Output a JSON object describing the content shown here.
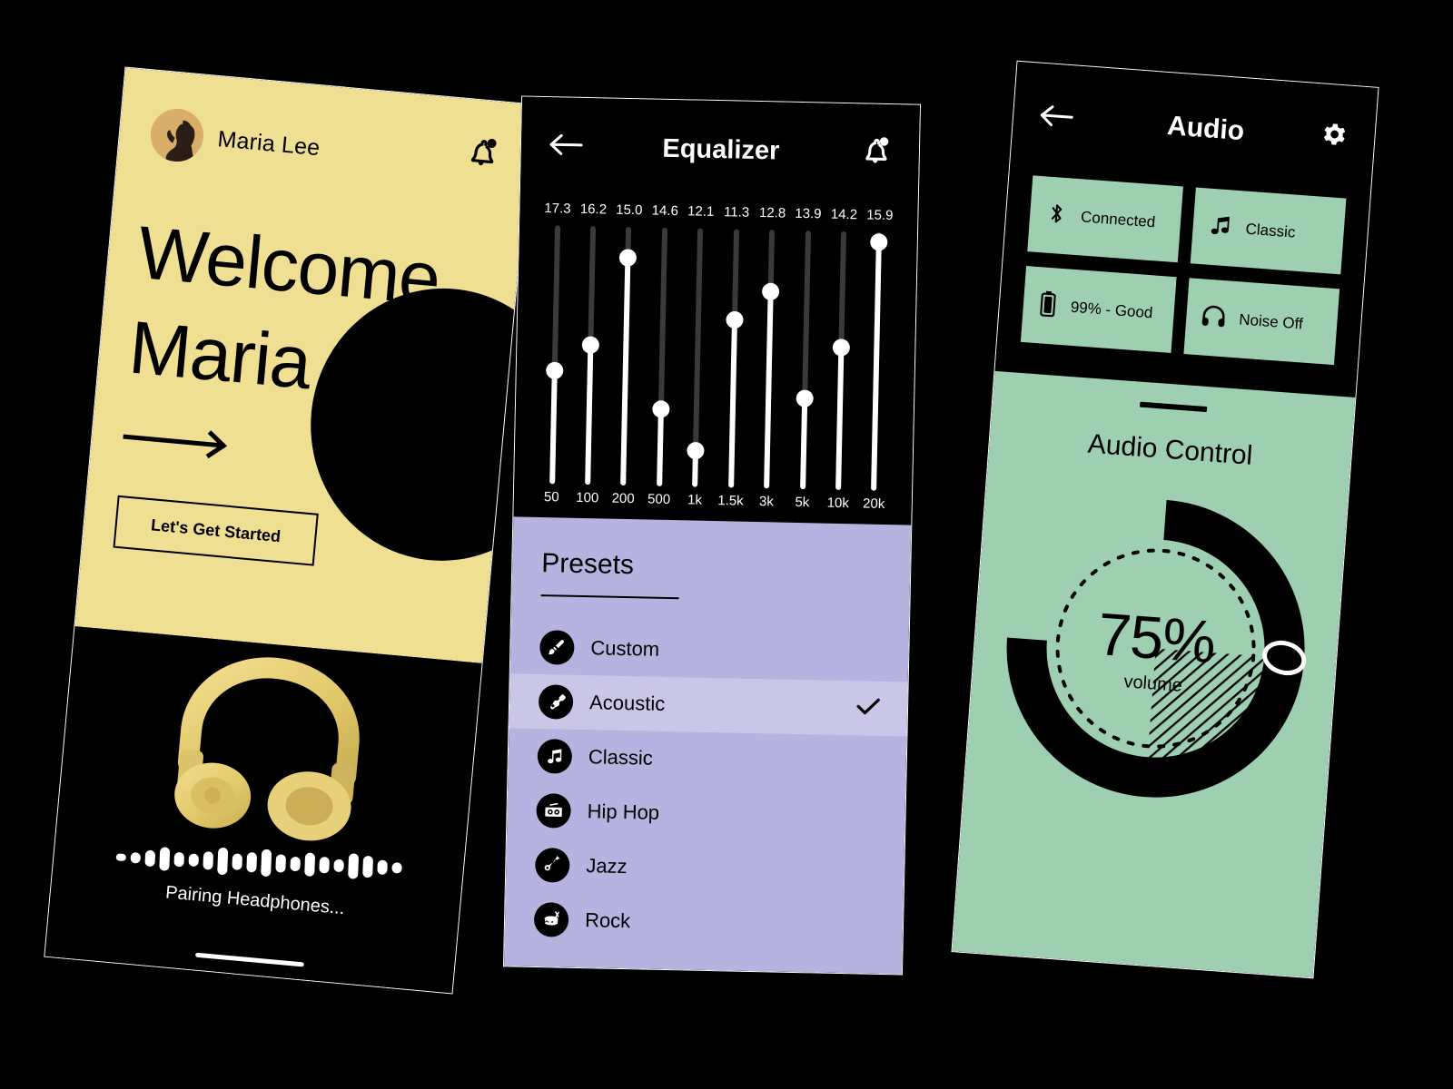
{
  "theme": {
    "yellow": "#EEDF92",
    "purple": "#B6B3E0",
    "purple_selected": "#C9C6E8",
    "green": "#9ECFB0",
    "black": "#000000",
    "white": "#FFFFFF"
  },
  "welcome": {
    "user_name": "Maria Lee",
    "avatar_icon": "user-avatar-photo",
    "bell_icon": "notification-bell-icon",
    "headline_line1": "Welcome,",
    "headline_line2": "Maria",
    "arrow_icon": "arrow-right-icon",
    "cta_label": "Let's Get Started",
    "headphones_icon": "headphones-product-image",
    "status_text": "Pairing Headphones...",
    "waveform_bars": [
      8,
      12,
      18,
      26,
      16,
      14,
      20,
      30,
      18,
      22,
      30,
      20,
      16,
      26,
      18,
      14,
      28,
      24,
      16,
      12
    ]
  },
  "equalizer": {
    "back_icon": "arrow-left-icon",
    "title": "Equalizer",
    "bell_icon": "notification-bell-icon",
    "bands": [
      {
        "freq": "50",
        "value": "17.3",
        "pos": 56
      },
      {
        "freq": "100",
        "value": "16.2",
        "pos": 46
      },
      {
        "freq": "200",
        "value": "15.0",
        "pos": 12
      },
      {
        "freq": "500",
        "value": "14.6",
        "pos": 70
      },
      {
        "freq": "1k",
        "value": "12.1",
        "pos": 86
      },
      {
        "freq": "1.5k",
        "value": "11.3",
        "pos": 35
      },
      {
        "freq": "3k",
        "value": "12.8",
        "pos": 24
      },
      {
        "freq": "5k",
        "value": "13.9",
        "pos": 65
      },
      {
        "freq": "10k",
        "value": "14.2",
        "pos": 45
      },
      {
        "freq": "20k",
        "value": "15.9",
        "pos": 4
      }
    ],
    "presets_heading": "Presets",
    "presets": [
      {
        "label": "Custom",
        "icon": "paintbrush-icon",
        "selected": false
      },
      {
        "label": "Acoustic",
        "icon": "guitar-icon",
        "selected": true
      },
      {
        "label": "Classic",
        "icon": "music-note-icon",
        "selected": false
      },
      {
        "label": "Hip Hop",
        "icon": "boombox-icon",
        "selected": false
      },
      {
        "label": "Jazz",
        "icon": "saxophone-icon",
        "selected": false
      },
      {
        "label": "Rock",
        "icon": "drum-icon",
        "selected": false
      }
    ],
    "check_icon": "checkmark-icon"
  },
  "audio": {
    "back_icon": "arrow-left-icon",
    "title": "Audio",
    "settings_icon": "gear-icon",
    "cards": [
      {
        "label": "Connected",
        "icon": "bluetooth-icon"
      },
      {
        "label": "Classic",
        "icon": "music-note-icon"
      },
      {
        "label": "99% - Good",
        "icon": "battery-icon"
      },
      {
        "label": "Noise Off",
        "icon": "headphones-icon"
      }
    ],
    "panel_title": "Audio Control",
    "volume_value": "75%",
    "volume_label": "volume",
    "volume_percent": 75,
    "drag_handle_icon": "drag-handle-icon",
    "knob_icon": "volume-knob-icon"
  }
}
